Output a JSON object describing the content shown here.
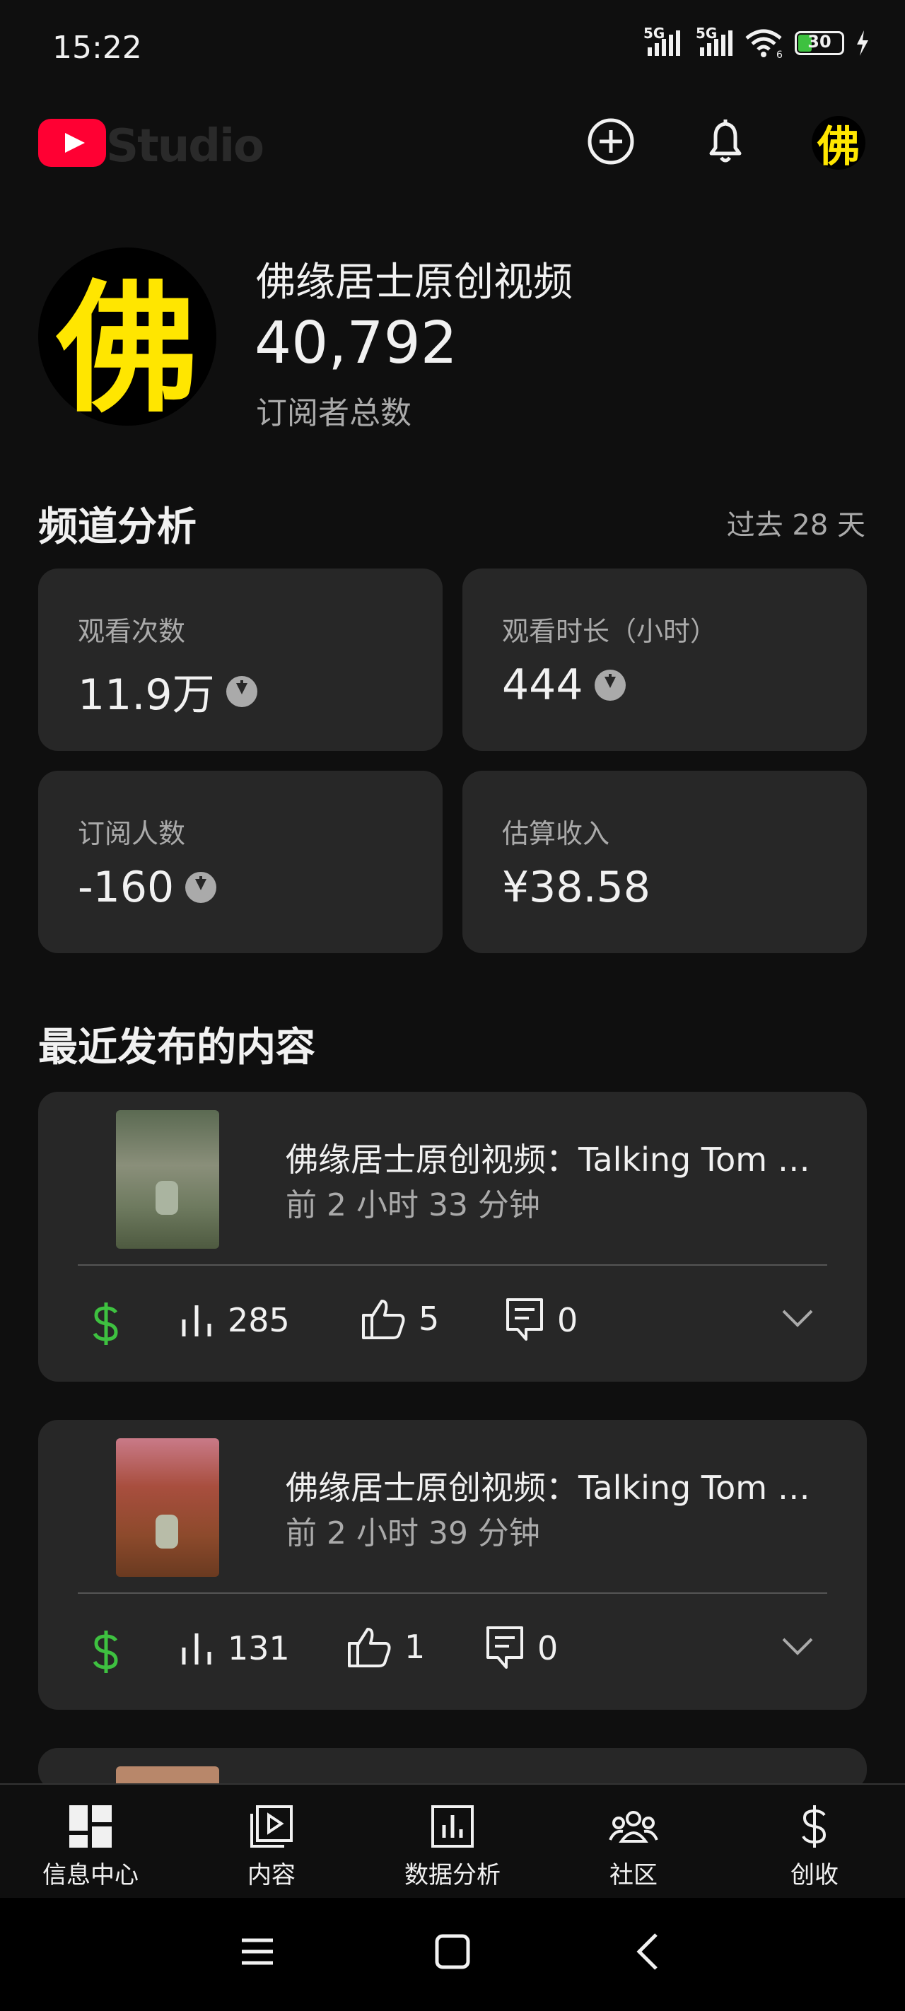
{
  "status_bar": {
    "time": "15:22",
    "signal1": "5G",
    "signal2": "5G",
    "wifi_label": "6",
    "battery": "30"
  },
  "header": {
    "logo_text": "Studio"
  },
  "channel": {
    "name": "佛缘居士原创视频",
    "avatar_char": "佛",
    "subscribers": "40,792",
    "subscribers_label": "订阅者总数"
  },
  "analytics": {
    "title": "频道分析",
    "range": "过去 28 天",
    "metrics": [
      {
        "label": "观看次数",
        "value": "11.9万",
        "trend": "down"
      },
      {
        "label": "观看时长（小时）",
        "value": "444",
        "trend": "down"
      },
      {
        "label": "订阅人数",
        "value": "-160",
        "trend": "down"
      },
      {
        "label": "估算收入",
        "value": "¥38.58",
        "trend": "none"
      }
    ]
  },
  "recent": {
    "title": "最近发布的内容",
    "items": [
      {
        "title": "佛缘居士原创视频：Talking Tom …",
        "time": "前 2 小时 33 分钟",
        "views": "285",
        "likes": "5",
        "comments": "0"
      },
      {
        "title": "佛缘居士原创视频：Talking Tom …",
        "time": "前 2 小时 39 分钟",
        "views": "131",
        "likes": "1",
        "comments": "0"
      }
    ]
  },
  "nav": [
    {
      "label": "信息中心",
      "icon": "dashboard-icon"
    },
    {
      "label": "内容",
      "icon": "content-icon"
    },
    {
      "label": "数据分析",
      "icon": "analytics-icon"
    },
    {
      "label": "社区",
      "icon": "community-icon"
    },
    {
      "label": "创收",
      "icon": "dollar-icon"
    }
  ],
  "colors": {
    "background": "#0f0f0f",
    "card": "#272727",
    "accent_red": "#ff0033",
    "money_green": "#3ec140",
    "avatar_yellow": "#ffe600"
  }
}
